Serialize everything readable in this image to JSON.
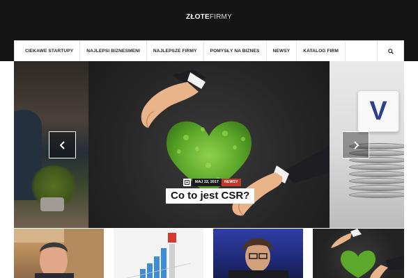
{
  "site": {
    "logo_bold": "ZŁOTE",
    "logo_light": "FIRMY"
  },
  "nav": {
    "items": [
      {
        "label": "CIEKAWE STARTUPY"
      },
      {
        "label": "NAJLEPSI BIZNESMENI"
      },
      {
        "label": "NAJLEPSZE FIRMY"
      },
      {
        "label": "POMYSŁY NA BIZNES"
      },
      {
        "label": "NEWSY"
      },
      {
        "label": "KATALOG FIRM"
      }
    ],
    "search_icon": "search-icon"
  },
  "slider": {
    "featured": {
      "date": "MAJ 22, 2017",
      "category": "NEWSY",
      "title": "Co to jest CSR?"
    },
    "right_block_letter": "V",
    "prev_icon": "chevron-left-icon",
    "next_icon": "chevron-right-icon"
  },
  "colors": {
    "header_bg": "#141414",
    "category_badge": "#c0392b",
    "heart_green": "#5ca82a"
  }
}
